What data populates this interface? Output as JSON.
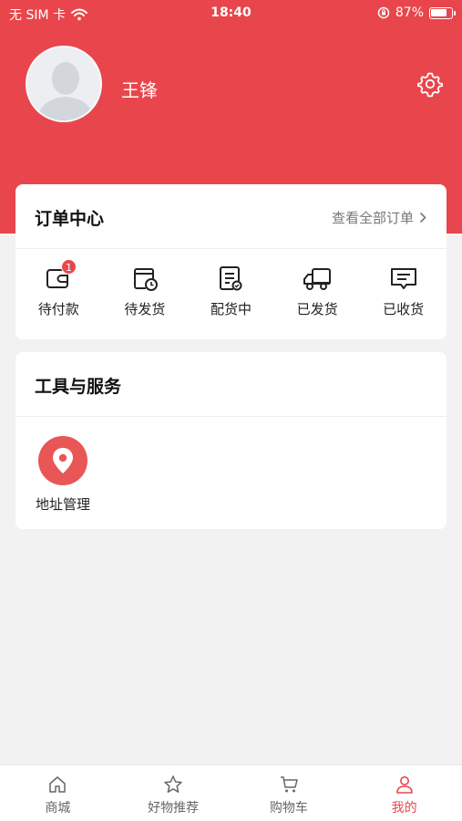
{
  "status_bar": {
    "carrier": "无 SIM 卡",
    "time": "18:40",
    "battery": "87%",
    "battery_level": 0.87
  },
  "profile": {
    "name": "王锋"
  },
  "orders": {
    "title": "订单中心",
    "view_all": "查看全部订单",
    "items": [
      {
        "label": "待付款",
        "icon": "wallet-icon",
        "badge": "1"
      },
      {
        "label": "待发货",
        "icon": "box-clock-icon"
      },
      {
        "label": "配货中",
        "icon": "document-check-icon"
      },
      {
        "label": "已发货",
        "icon": "truck-icon"
      },
      {
        "label": "已收货",
        "icon": "message-icon"
      }
    ]
  },
  "tools": {
    "title": "工具与服务",
    "items": [
      {
        "label": "地址管理",
        "icon": "location-pin-icon"
      }
    ]
  },
  "tabbar": {
    "items": [
      {
        "label": "商城",
        "icon": "home-icon",
        "active": false
      },
      {
        "label": "好物推荐",
        "icon": "star-icon",
        "active": false
      },
      {
        "label": "购物车",
        "icon": "cart-icon",
        "active": false
      },
      {
        "label": "我的",
        "icon": "user-icon",
        "active": true
      }
    ]
  },
  "colors": {
    "brand": "#e8464c",
    "background": "#f2f2f2",
    "tool_icon_bg": "#e85656"
  }
}
